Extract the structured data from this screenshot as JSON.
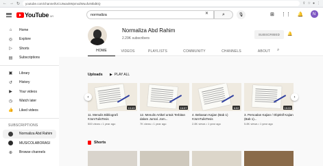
{
  "browser": {
    "url": "youtube.com/channel/UCUIwaxkWpmxdWuufuNIbdEQ"
  },
  "topbar": {
    "logo_text": "YouTube",
    "logo_region": "MY",
    "search_value": "normaliza",
    "avatar_letter": "N"
  },
  "sidebar": {
    "main": [
      {
        "label": "Home",
        "icon": "home-icon"
      },
      {
        "label": "Explore",
        "icon": "explore-icon"
      },
      {
        "label": "Shorts",
        "icon": "shorts-icon"
      },
      {
        "label": "Subscriptions",
        "icon": "subscriptions-icon"
      }
    ],
    "library": [
      {
        "label": "Library",
        "icon": "library-icon"
      },
      {
        "label": "History",
        "icon": "history-icon"
      },
      {
        "label": "Your videos",
        "icon": "your-videos-icon"
      },
      {
        "label": "Watch later",
        "icon": "watch-later-icon"
      },
      {
        "label": "Liked videos",
        "icon": "liked-icon"
      }
    ],
    "subscriptions_heading": "SUBSCRIPTIONS",
    "subscriptions": [
      {
        "label": "Normaliza Abd Rahim",
        "color": "#3a3a3a"
      },
      {
        "label": "MUSICOLABORASI",
        "color": "#2b2b2b"
      },
      {
        "label": "Browse channels",
        "color": ""
      }
    ]
  },
  "channel": {
    "name": "Normaliza Abd Rahim",
    "subscribers": "2.29K subscribers",
    "subscribed_label": "SUBSCRIBED"
  },
  "tabs": [
    "HOME",
    "VIDEOS",
    "PLAYLISTS",
    "COMMUNITY",
    "CHANNELS",
    "ABOUT"
  ],
  "uploads": {
    "heading": "Uploads",
    "play_all": "PLAY ALL",
    "videos": [
      {
        "title": "11. Menulis Bibliografi #JomTulisTesis",
        "meta": "500 views • 1 year ago",
        "duration": "10:43"
      },
      {
        "title": "12. Menulis Artikel untuk Terbitan dalam Jurnal. Jom...",
        "meta": "7K views • 1 year ago",
        "duration": "16:57"
      },
      {
        "title": "4. Bebasan Kajian (Bab 1) #JomTulisTesis",
        "meta": "2.8K views • 1 year ago",
        "duration": "6:52"
      },
      {
        "title": "3. Persoalan Kajian / Objektif Kajian (Bab 1)...",
        "meta": "5.8K views • 1 year ago",
        "duration": "15:33"
      }
    ]
  },
  "shorts_heading": "Shorts",
  "colors": {
    "brand_red": "#ff0000",
    "avatar": "#7e57c2"
  }
}
